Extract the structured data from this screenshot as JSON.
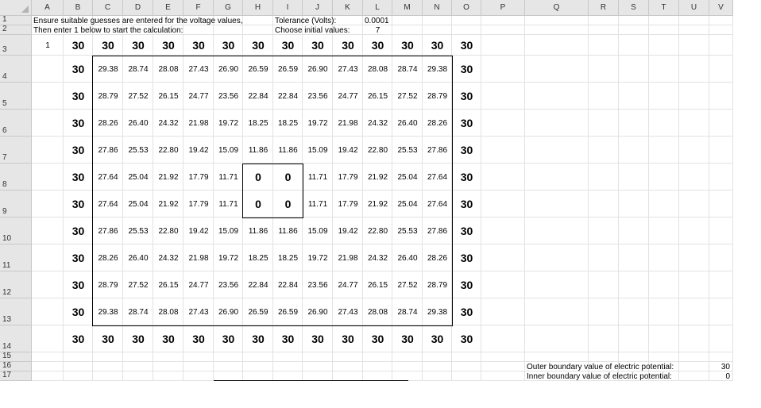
{
  "columns": [
    "A",
    "B",
    "C",
    "D",
    "E",
    "F",
    "G",
    "H",
    "I",
    "J",
    "K",
    "L",
    "M",
    "N",
    "O",
    "P",
    "Q",
    "R",
    "S",
    "T",
    "U",
    "V"
  ],
  "rows": [
    "1",
    "2",
    "3",
    "4",
    "5",
    "6",
    "7",
    "8",
    "9",
    "10",
    "11",
    "12",
    "13",
    "14",
    "15",
    "16",
    "17"
  ],
  "instructions": {
    "line1": "Ensure suitable guesses are entered for the voltage values,",
    "line2": "Then enter 1 below to start the calculation:",
    "tolerance_label": "Tolerance (Volts):",
    "tolerance_value": "0.0001",
    "initial_label": "Choose initial values:",
    "initial_value": "7"
  },
  "start_value": "1",
  "boundary_value": "30",
  "grid_values": [
    [
      "29.38",
      "28.74",
      "28.08",
      "27.43",
      "26.90",
      "26.59",
      "26.59",
      "26.90",
      "27.43",
      "28.08",
      "28.74",
      "29.38"
    ],
    [
      "28.79",
      "27.52",
      "26.15",
      "24.77",
      "23.56",
      "22.84",
      "22.84",
      "23.56",
      "24.77",
      "26.15",
      "27.52",
      "28.79"
    ],
    [
      "28.26",
      "26.40",
      "24.32",
      "21.98",
      "19.72",
      "18.25",
      "18.25",
      "19.72",
      "21.98",
      "24.32",
      "26.40",
      "28.26"
    ],
    [
      "27.86",
      "25.53",
      "22.80",
      "19.42",
      "15.09",
      "11.86",
      "11.86",
      "15.09",
      "19.42",
      "22.80",
      "25.53",
      "27.86"
    ],
    [
      "27.64",
      "25.04",
      "21.92",
      "17.79",
      "11.71",
      "0",
      "0",
      "11.71",
      "17.79",
      "21.92",
      "25.04",
      "27.64"
    ],
    [
      "27.64",
      "25.04",
      "21.92",
      "17.79",
      "11.71",
      "0",
      "0",
      "11.71",
      "17.79",
      "21.92",
      "25.04",
      "27.64"
    ],
    [
      "27.86",
      "25.53",
      "22.80",
      "19.42",
      "15.09",
      "11.86",
      "11.86",
      "15.09",
      "19.42",
      "22.80",
      "25.53",
      "27.86"
    ],
    [
      "28.26",
      "26.40",
      "24.32",
      "21.98",
      "19.72",
      "18.25",
      "18.25",
      "19.72",
      "21.98",
      "24.32",
      "26.40",
      "28.26"
    ],
    [
      "28.79",
      "27.52",
      "26.15",
      "24.77",
      "23.56",
      "22.84",
      "22.84",
      "23.56",
      "24.77",
      "26.15",
      "27.52",
      "28.79"
    ],
    [
      "29.38",
      "28.74",
      "28.08",
      "27.43",
      "26.90",
      "26.59",
      "26.59",
      "26.90",
      "27.43",
      "28.08",
      "28.74",
      "29.38"
    ]
  ],
  "side_notes": {
    "outer_label": "Outer boundary value of electric potential:",
    "outer_value": "30",
    "inner_label": "Inner boundary value of electric potential:",
    "inner_value": "0"
  }
}
